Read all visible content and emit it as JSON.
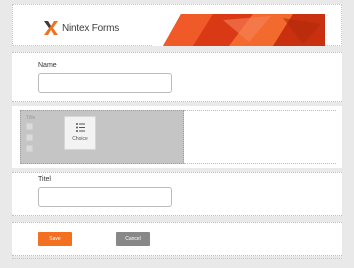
{
  "header": {
    "logo_text": "Nintex Forms"
  },
  "fields": {
    "name_label": "Name",
    "titel_label": "Titel"
  },
  "choice": {
    "ghost_title": "Title",
    "tile_label": "Choice"
  },
  "buttons": {
    "save_label": "Save",
    "cancel_label": "Cancel"
  },
  "colors": {
    "brand_orange": "#f37021",
    "cancel_gray": "#888888"
  }
}
